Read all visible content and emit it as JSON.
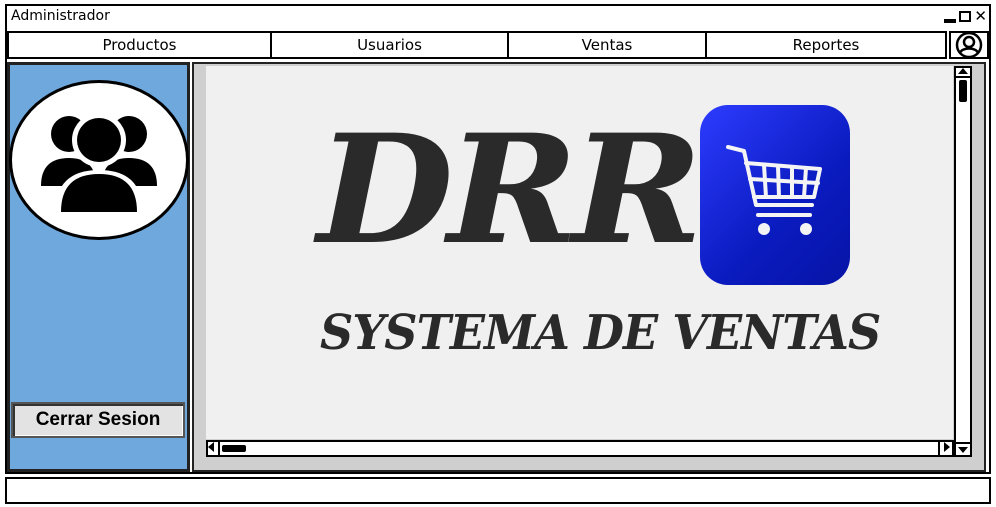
{
  "window": {
    "title": "Administrador"
  },
  "menu": {
    "items": [
      {
        "label": "Productos"
      },
      {
        "label": "Usuarios"
      },
      {
        "label": "Ventas"
      },
      {
        "label": "Reportes"
      }
    ]
  },
  "sidebar": {
    "logout_label": "Cerrar Sesion"
  },
  "main": {
    "logo_text": "DRR",
    "tagline": "SYSTEMA DE VENTAS"
  },
  "colors": {
    "sidebar": "#6fa8dc",
    "content_bg": "#f0f0f0",
    "cart_tile": "#0a1bbf"
  },
  "icons": [
    "minimize-icon",
    "maximize-icon",
    "close-icon",
    "user-account-icon",
    "user-group-icon",
    "shopping-cart-icon"
  ]
}
